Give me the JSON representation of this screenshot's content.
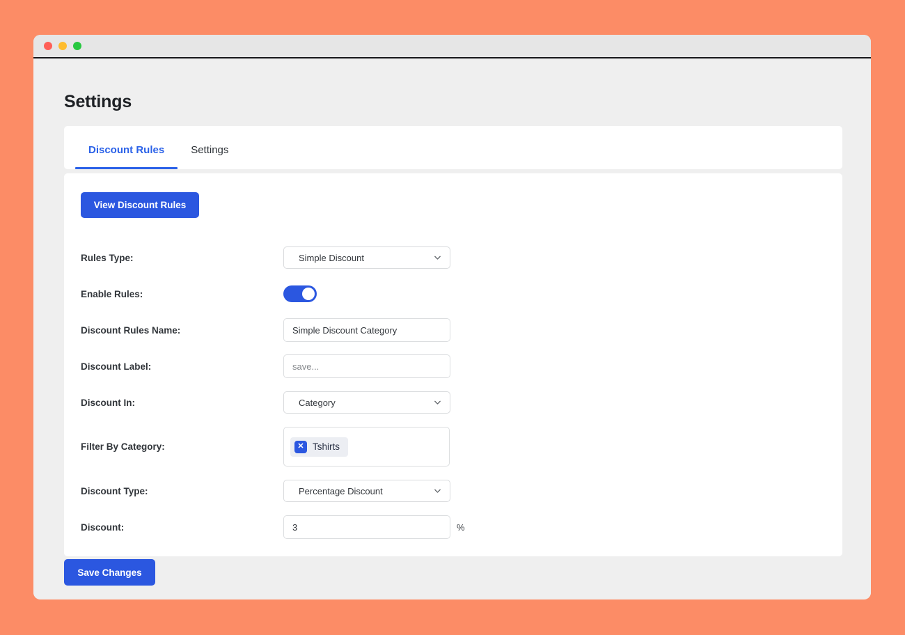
{
  "window": {
    "traffic_lights": [
      {
        "name": "close",
        "color": "#ff5f57"
      },
      {
        "name": "minimize",
        "color": "#febc2e"
      },
      {
        "name": "maximize",
        "color": "#28c840"
      }
    ]
  },
  "theme": {
    "page_background": "#fc8c66",
    "window_background": "#efefef",
    "card_background": "#ffffff",
    "accent": "#2b57e0",
    "tab_active": "#2b62e8",
    "label_text": "#32363b"
  },
  "page": {
    "title": "Settings"
  },
  "tabs": [
    {
      "label": "Discount Rules",
      "active": true
    },
    {
      "label": "Settings",
      "active": false
    }
  ],
  "toolbar": {
    "view_rules_label": "View Discount Rules"
  },
  "form": {
    "rows": [
      {
        "key": "rules_type",
        "label": "Rules Type:",
        "control": "select",
        "value": "Simple Discount"
      },
      {
        "key": "enable_rules",
        "label": "Enable Rules:",
        "control": "toggle",
        "value": "on"
      },
      {
        "key": "discount_rules_name",
        "label": "Discount Rules Name:",
        "control": "text",
        "value": "Simple Discount Category",
        "placeholder": ""
      },
      {
        "key": "discount_label",
        "label": "Discount Label:",
        "control": "text",
        "value": "",
        "placeholder": "save..."
      },
      {
        "key": "discount_in",
        "label": "Discount In:",
        "control": "select",
        "value": "Category"
      },
      {
        "key": "filter_by_category",
        "label": "Filter By Category:",
        "control": "tags",
        "tags": [
          {
            "label": "Tshirts",
            "remove_icon": "close-icon"
          }
        ]
      },
      {
        "key": "discount_type",
        "label": "Discount Type:",
        "control": "select",
        "value": "Percentage Discount"
      },
      {
        "key": "discount",
        "label": "Discount:",
        "control": "text",
        "value": "3",
        "placeholder": "",
        "suffix": "%"
      }
    ]
  },
  "footer": {
    "save_label": "Save Changes"
  },
  "icons": {
    "chevron_down": "chevron-down-icon",
    "tag_close": "close-icon"
  }
}
